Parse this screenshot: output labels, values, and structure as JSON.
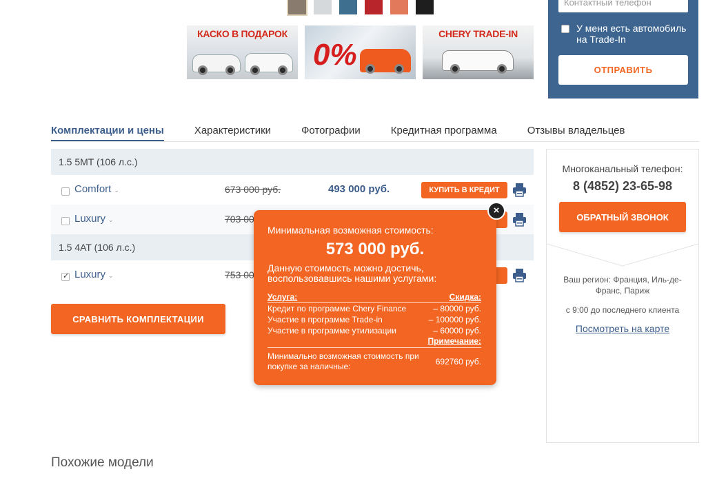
{
  "colors": {
    "accent": "#f26522",
    "brand_blue": "#3d5e8c",
    "form_bg": "#3d6590",
    "swatches": [
      "#8a7b6f",
      "#d5d9dc",
      "#3f6f8f",
      "#b8262c",
      "#e2795a",
      "#1e1e1e"
    ]
  },
  "promos": [
    {
      "title": "КАСКО В ПОДАРОК"
    },
    {
      "title": "0%"
    },
    {
      "title": "CHERY TRADE-IN"
    }
  ],
  "form": {
    "phone_placeholder": "Контактный телефон",
    "tradein_label": "У меня есть автомобиль на Trade-In",
    "tradein_checked": false,
    "send_label": "Отправить"
  },
  "tabs": [
    {
      "label": "Комплектации и цены",
      "active": true
    },
    {
      "label": "Характеристики",
      "active": false
    },
    {
      "label": "Фотографии",
      "active": false
    },
    {
      "label": "Кредитная программа",
      "active": false
    },
    {
      "label": "Отзывы владельцев",
      "active": false
    }
  ],
  "groups": [
    {
      "name": "1.5 5MT (106 л.с.)",
      "rows": [
        {
          "trim": "Comfort",
          "old_price": "673 000 руб.",
          "price": "493 000 руб.",
          "credit_label": "Купить в кредит",
          "checked": false
        },
        {
          "trim": "Luxury",
          "old_price": "703 000 руб.",
          "checked": false
        }
      ]
    },
    {
      "name": "1.5 4AT (106 л.с.)",
      "rows": [
        {
          "trim": "Luxury",
          "old_price": "753 000 руб.",
          "checked": true
        }
      ]
    }
  ],
  "compare_label": "Сравнить комплектации",
  "contact": {
    "label": "Многоканальный телефон:",
    "phone": "8 (4852) 23-65-98",
    "callback_label": "Обратный звонок",
    "region": "Ваш регион: Франция, Иль-де-Франс, Париж",
    "hours": "с 9:00 до последнего клиента",
    "map_link": "Посмотреть на карте"
  },
  "popup": {
    "title": "Минимальная возможная стоимость:",
    "price": "573 000 руб.",
    "desc": "Данную стоимость можно достичь, воспользовавшись нашими услугами:",
    "col_service": "Услуга:",
    "col_discount": "Скидка:",
    "services": [
      {
        "name": "Кредит по программе Chery Finance",
        "discount": "– 80000 руб."
      },
      {
        "name": "Участие в программе Trade-in",
        "discount": "– 100000 руб."
      },
      {
        "name": "Участие в программе утилизации",
        "discount": "– 60000 руб."
      }
    ],
    "note_label": "Примечание:",
    "cash_label": "Минимально возможная стоимость при покупке за наличные:",
    "cash_value": "692760 руб."
  },
  "similar_title": "Похожие модели"
}
